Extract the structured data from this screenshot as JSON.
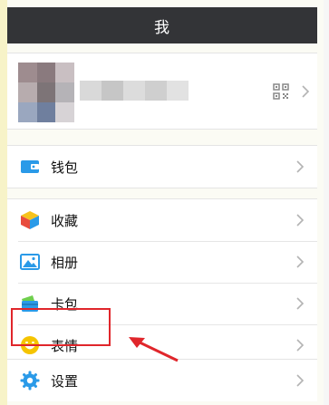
{
  "header": {
    "title": "我"
  },
  "profile": {
    "qr_icon": "qr-code-icon",
    "chevron_icon": "chevron-right-icon"
  },
  "menu": {
    "wallet": {
      "label": "钱包",
      "icon": "wallet-icon",
      "color": "#2a9ae8"
    },
    "favorites": {
      "label": "收藏",
      "icon": "cube-icon"
    },
    "album": {
      "label": "相册",
      "icon": "photo-icon",
      "color": "#2a9ae8"
    },
    "cards": {
      "label": "卡包",
      "icon": "card-icon",
      "color": "#39b54a"
    },
    "stickers": {
      "label": "表情",
      "icon": "smiley-icon",
      "color": "#f5c400"
    },
    "settings": {
      "label": "设置",
      "icon": "gear-icon",
      "color": "#2a9ae8"
    }
  },
  "annotation": {
    "highlight_color": "#e0262b"
  }
}
